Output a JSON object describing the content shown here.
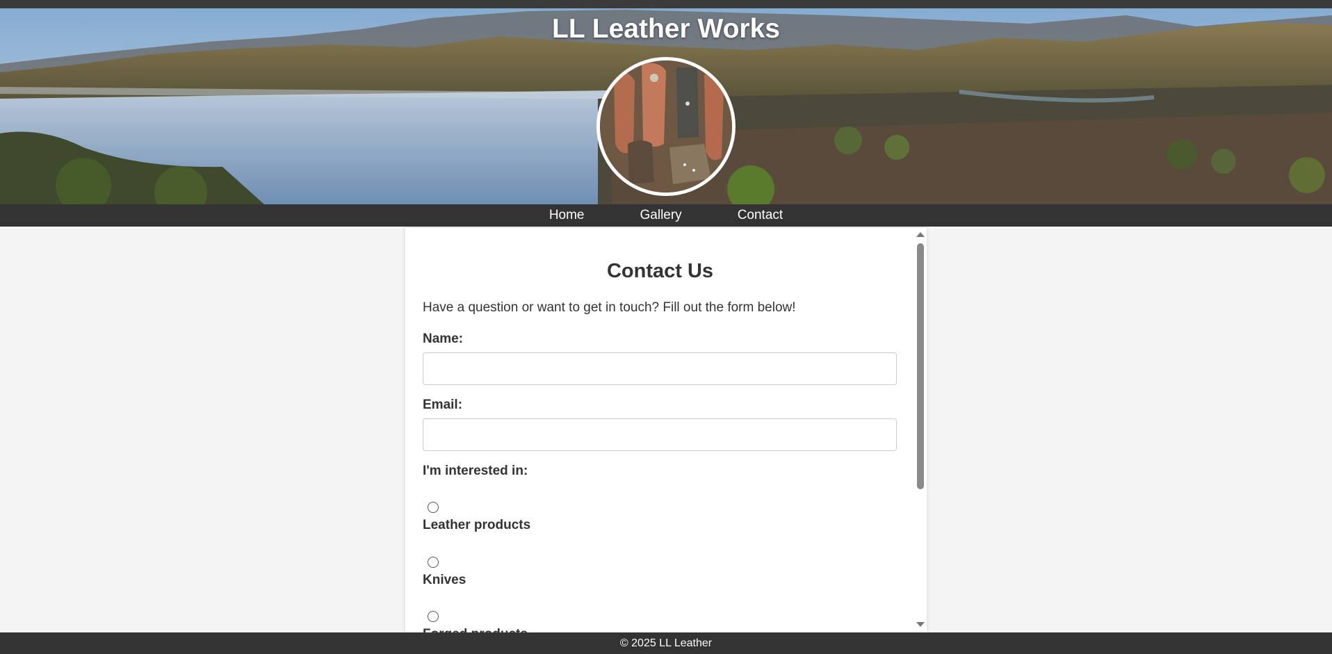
{
  "site": {
    "title": "LL Leather Works"
  },
  "nav": {
    "items": [
      "Home",
      "Gallery",
      "Contact"
    ]
  },
  "contact": {
    "heading": "Contact Us",
    "intro": "Have a question or want to get in touch? Fill out the form below!",
    "name_label": "Name:",
    "name_value": "",
    "email_label": "Email:",
    "email_value": "",
    "interest_label": "I'm interested in:",
    "options": [
      "Leather products",
      "Knives",
      "Forged products"
    ]
  },
  "footer": {
    "text": "© 2025 LL Leather"
  },
  "colors": {
    "bar": "#333333",
    "page_bg": "#f4f4f4",
    "panel_bg": "#ffffff",
    "text": "#333333"
  }
}
